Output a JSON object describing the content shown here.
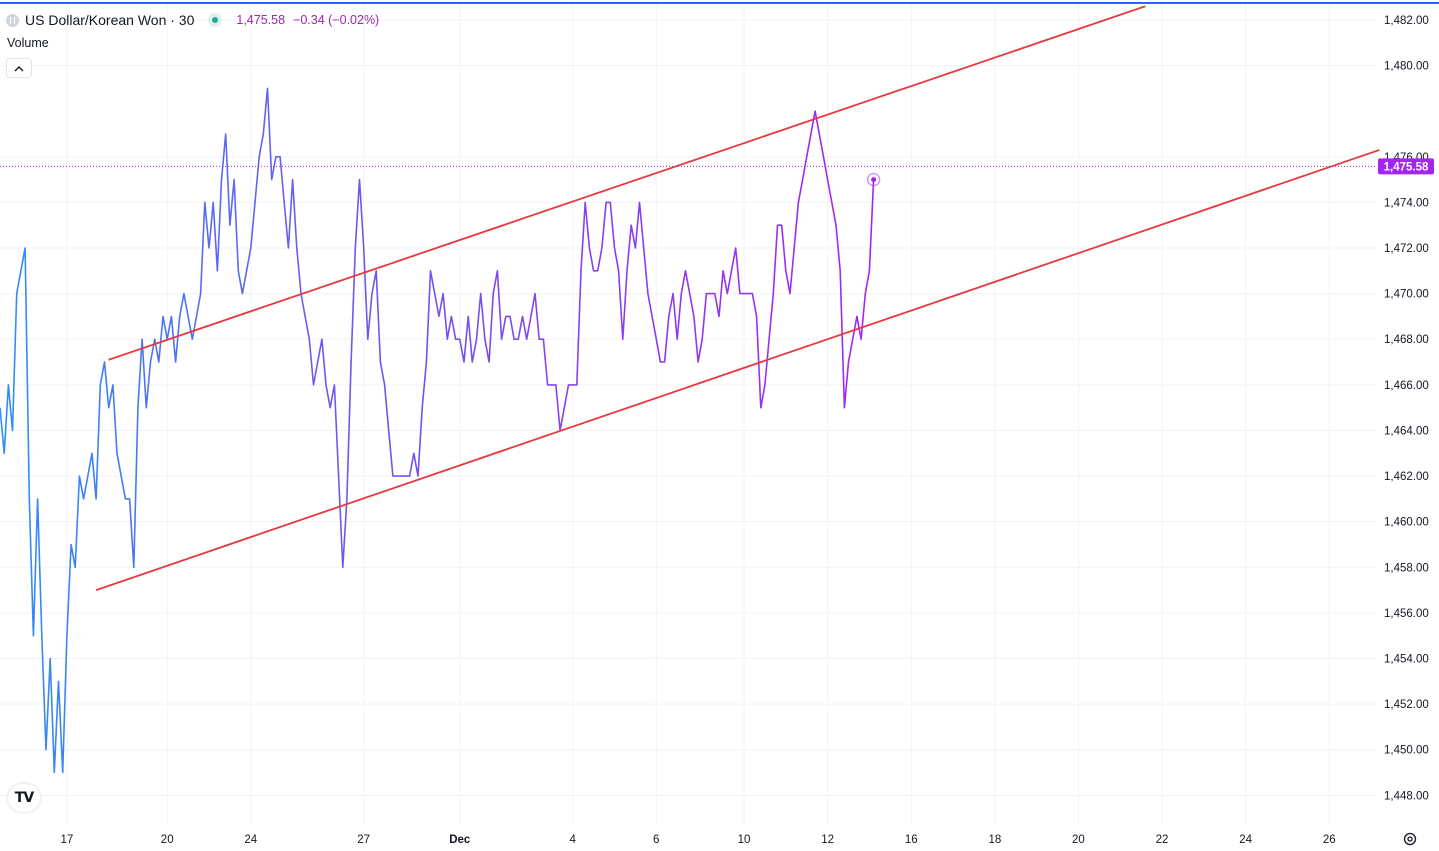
{
  "header": {
    "symbol": "US Dollar/Korean Won · 30",
    "price": "1,475.58",
    "change": "−0.34 (−0.02%)",
    "volume_label": "Volume"
  },
  "logo_text": "TV",
  "colors": {
    "price_line_start": "#2f8ef5",
    "price_line_end": "#a326f0",
    "channel": "#e8383d",
    "price_tag": "#a326f0",
    "grid": "#f0f3fa",
    "top_border": "#2962ff"
  },
  "chart_data": {
    "type": "line",
    "title": "US Dollar/Korean Won · 30",
    "xlabel": "",
    "ylabel": "",
    "ylim": [
      1446.7,
      1482.7
    ],
    "xlim": [
      0,
      300
    ],
    "last_price": 1475.58,
    "y_ticks": [
      1448,
      1450,
      1452,
      1454,
      1456,
      1458,
      1460,
      1462,
      1464,
      1466,
      1468,
      1470,
      1472,
      1474,
      1476,
      1480,
      1482
    ],
    "y_tick_labels": [
      "1,448.00",
      "1,450.00",
      "1,452.00",
      "1,454.00",
      "1,456.00",
      "1,458.00",
      "1,460.00",
      "1,462.00",
      "1,464.00",
      "1,466.00",
      "1,468.00",
      "1,470.00",
      "1,472.00",
      "1,474.00",
      "1,476.00",
      "1,480.00",
      "1,482.00"
    ],
    "x_ticks": [
      {
        "x": 16,
        "label": "17"
      },
      {
        "x": 40,
        "label": "20"
      },
      {
        "x": 60,
        "label": "24"
      },
      {
        "x": 87,
        "label": "27"
      },
      {
        "x": 110,
        "label": "Dec"
      },
      {
        "x": 137,
        "label": "4"
      },
      {
        "x": 157,
        "label": "6"
      },
      {
        "x": 178,
        "label": "10"
      },
      {
        "x": 198,
        "label": "12"
      },
      {
        "x": 218,
        "label": "16"
      },
      {
        "x": 238,
        "label": "18"
      },
      {
        "x": 258,
        "label": "20"
      },
      {
        "x": 278,
        "label": "22"
      },
      {
        "x": 298,
        "label": "24"
      },
      {
        "x": 318,
        "label": "26"
      }
    ],
    "series": [
      {
        "values": [
          [
            0,
            1465
          ],
          [
            1,
            1463
          ],
          [
            2,
            1466
          ],
          [
            3,
            1464
          ],
          [
            4,
            1470
          ],
          [
            5,
            1471
          ],
          [
            6,
            1472
          ],
          [
            7,
            1461
          ],
          [
            8,
            1455
          ],
          [
            9,
            1461
          ],
          [
            10,
            1455
          ],
          [
            11,
            1450
          ],
          [
            12,
            1454
          ],
          [
            13,
            1449
          ],
          [
            14,
            1453
          ],
          [
            15,
            1449
          ],
          [
            16,
            1455
          ],
          [
            17,
            1459
          ],
          [
            18,
            1458
          ],
          [
            19,
            1462
          ],
          [
            20,
            1461
          ],
          [
            21,
            1462
          ],
          [
            22,
            1463
          ],
          [
            23,
            1461
          ],
          [
            24,
            1466
          ],
          [
            25,
            1467
          ],
          [
            26,
            1465
          ],
          [
            27,
            1466
          ],
          [
            28,
            1463
          ],
          [
            29,
            1462
          ],
          [
            30,
            1461
          ],
          [
            31,
            1461
          ],
          [
            32,
            1458
          ],
          [
            33,
            1465
          ],
          [
            34,
            1468
          ],
          [
            35,
            1465
          ],
          [
            36,
            1467
          ],
          [
            37,
            1468
          ],
          [
            38,
            1467
          ],
          [
            39,
            1469
          ],
          [
            40,
            1468
          ],
          [
            41,
            1469
          ],
          [
            42,
            1467
          ],
          [
            43,
            1469
          ],
          [
            44,
            1470
          ],
          [
            45,
            1469
          ],
          [
            46,
            1468
          ],
          [
            47,
            1469
          ],
          [
            48,
            1470
          ],
          [
            49,
            1474
          ],
          [
            50,
            1472
          ],
          [
            51,
            1474
          ],
          [
            52,
            1471
          ],
          [
            53,
            1475
          ],
          [
            54,
            1477
          ],
          [
            55,
            1473
          ],
          [
            56,
            1475
          ],
          [
            57,
            1471
          ],
          [
            58,
            1470
          ],
          [
            59,
            1471
          ],
          [
            60,
            1472
          ],
          [
            61,
            1474
          ],
          [
            62,
            1476
          ],
          [
            63,
            1477
          ],
          [
            64,
            1479
          ],
          [
            65,
            1475
          ],
          [
            66,
            1476
          ],
          [
            67,
            1476
          ],
          [
            68,
            1474
          ],
          [
            69,
            1472
          ],
          [
            70,
            1475
          ],
          [
            71,
            1472
          ],
          [
            72,
            1470
          ],
          [
            73,
            1469
          ],
          [
            74,
            1468
          ],
          [
            75,
            1466
          ],
          [
            76,
            1467
          ],
          [
            77,
            1468
          ],
          [
            78,
            1466
          ],
          [
            79,
            1465
          ],
          [
            80,
            1466
          ],
          [
            81,
            1462
          ],
          [
            82,
            1458
          ],
          [
            83,
            1461
          ],
          [
            84,
            1467
          ],
          [
            85,
            1472
          ],
          [
            86,
            1475
          ],
          [
            87,
            1472
          ],
          [
            88,
            1468
          ],
          [
            89,
            1470
          ],
          [
            90,
            1471
          ],
          [
            91,
            1467
          ],
          [
            92,
            1466
          ],
          [
            93,
            1464
          ],
          [
            94,
            1462
          ],
          [
            95,
            1462
          ],
          [
            96,
            1462
          ],
          [
            97,
            1462
          ],
          [
            98,
            1462
          ],
          [
            99,
            1463
          ],
          [
            100,
            1462
          ],
          [
            101,
            1465
          ],
          [
            102,
            1467
          ],
          [
            103,
            1471
          ],
          [
            104,
            1470
          ],
          [
            105,
            1469
          ],
          [
            106,
            1470
          ],
          [
            107,
            1468
          ],
          [
            108,
            1469
          ],
          [
            109,
            1468
          ],
          [
            110,
            1468
          ],
          [
            111,
            1467
          ],
          [
            112,
            1469
          ],
          [
            113,
            1467
          ],
          [
            114,
            1468
          ],
          [
            115,
            1470
          ],
          [
            116,
            1468
          ],
          [
            117,
            1467
          ],
          [
            118,
            1470
          ],
          [
            119,
            1471
          ],
          [
            120,
            1468
          ],
          [
            121,
            1469
          ],
          [
            122,
            1469
          ],
          [
            123,
            1468
          ],
          [
            124,
            1468
          ],
          [
            125,
            1469
          ],
          [
            126,
            1468
          ],
          [
            127,
            1469
          ],
          [
            128,
            1470
          ],
          [
            129,
            1468
          ],
          [
            130,
            1468
          ],
          [
            131,
            1466
          ],
          [
            132,
            1466
          ],
          [
            133,
            1466
          ],
          [
            134,
            1464
          ],
          [
            135,
            1465
          ],
          [
            136,
            1466
          ],
          [
            137,
            1466
          ],
          [
            138,
            1466
          ],
          [
            139,
            1471
          ],
          [
            140,
            1474
          ],
          [
            141,
            1472
          ],
          [
            142,
            1471
          ],
          [
            143,
            1471
          ],
          [
            144,
            1472
          ],
          [
            145,
            1474
          ],
          [
            146,
            1474
          ],
          [
            147,
            1472
          ],
          [
            148,
            1471
          ],
          [
            149,
            1468
          ],
          [
            150,
            1471
          ],
          [
            151,
            1473
          ],
          [
            152,
            1472
          ],
          [
            153,
            1474
          ],
          [
            154,
            1472
          ],
          [
            155,
            1470
          ],
          [
            156,
            1469
          ],
          [
            157,
            1468
          ],
          [
            158,
            1467
          ],
          [
            159,
            1467
          ],
          [
            160,
            1469
          ],
          [
            161,
            1470
          ],
          [
            162,
            1468
          ],
          [
            163,
            1470
          ],
          [
            164,
            1471
          ],
          [
            165,
            1470
          ],
          [
            166,
            1469
          ],
          [
            167,
            1467
          ],
          [
            168,
            1468
          ],
          [
            169,
            1470
          ],
          [
            170,
            1470
          ],
          [
            171,
            1470
          ],
          [
            172,
            1469
          ],
          [
            173,
            1471
          ],
          [
            174,
            1470
          ],
          [
            175,
            1471
          ],
          [
            176,
            1472
          ],
          [
            177,
            1470
          ],
          [
            178,
            1470
          ],
          [
            179,
            1470
          ],
          [
            180,
            1470
          ],
          [
            181,
            1469
          ],
          [
            182,
            1465
          ],
          [
            183,
            1466
          ],
          [
            184,
            1468
          ],
          [
            185,
            1470
          ],
          [
            186,
            1473
          ],
          [
            187,
            1473
          ],
          [
            188,
            1471
          ],
          [
            189,
            1470
          ],
          [
            190,
            1472
          ],
          [
            191,
            1474
          ],
          [
            192,
            1475
          ],
          [
            193,
            1476
          ],
          [
            194,
            1477
          ],
          [
            195,
            1478
          ],
          [
            196,
            1477
          ],
          [
            197,
            1476
          ],
          [
            198,
            1475
          ],
          [
            199,
            1474
          ],
          [
            200,
            1473
          ],
          [
            201,
            1471
          ],
          [
            202,
            1465
          ],
          [
            203,
            1467
          ],
          [
            204,
            1468
          ],
          [
            205,
            1469
          ],
          [
            206,
            1468
          ],
          [
            207,
            1470
          ],
          [
            208,
            1471
          ],
          [
            209,
            1475
          ]
        ]
      }
    ],
    "channel_lines": [
      {
        "points": [
          [
            26,
            1467.1
          ],
          [
            274,
            1482.6
          ]
        ]
      },
      {
        "points": [
          [
            23,
            1457.0
          ],
          [
            330,
            1476.3
          ]
        ]
      }
    ]
  }
}
